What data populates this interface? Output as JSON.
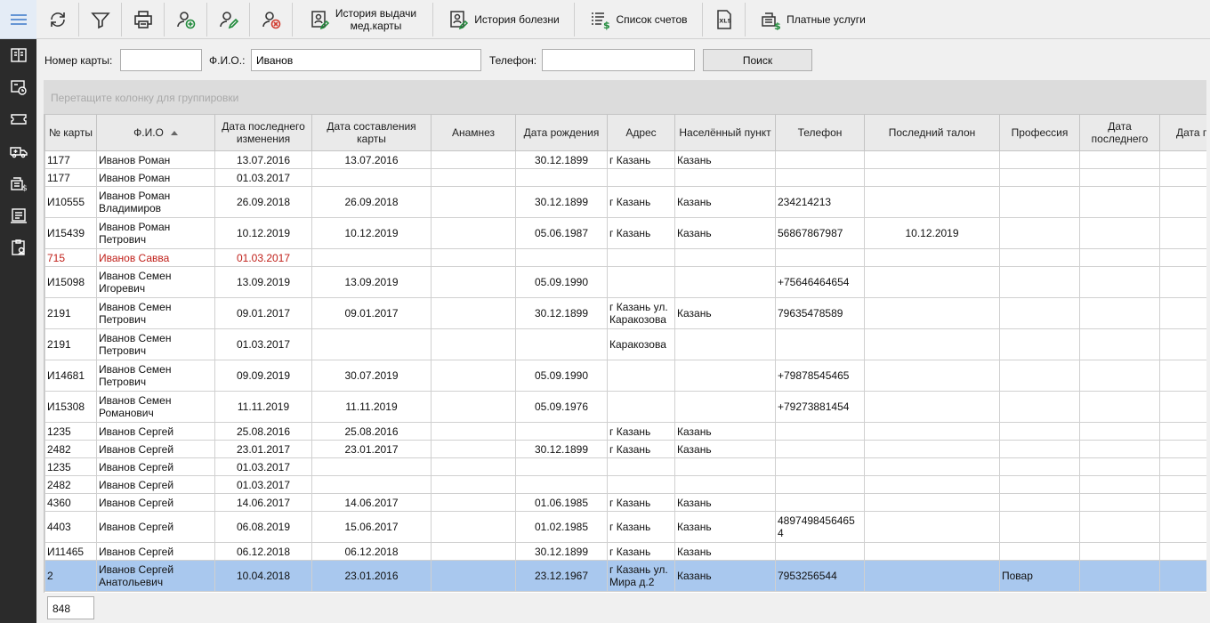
{
  "toolbar": {
    "refresh_icon": "refresh-icon",
    "filter_icon": "filter-icon",
    "print_icon": "print-icon",
    "add_patient_icon": "add-patient-icon",
    "edit_patient_icon": "edit-patient-icon",
    "delete_patient_icon": "delete-patient-icon",
    "issue_history_label": "История выдачи\nмед.карты",
    "disease_history_label": "История болезни",
    "invoices_label": "Список счетов",
    "xls_label": "XLS",
    "paid_services_label": "Платные услуги"
  },
  "search": {
    "card_label": "Номер карты:",
    "card_value": "",
    "fio_label": "Ф.И.О.:",
    "fio_value": "Иванов",
    "phone_label": "Телефон:",
    "phone_value": "",
    "search_button": "Поиск"
  },
  "group_panel_text": "Перетащите колонку для группировки",
  "columns": [
    "№ карты",
    "Ф.И.О",
    "Дата последнего изменения",
    "Дата составления карты",
    "Анамнез",
    "Дата рождения",
    "Адрес",
    "Населённый пункт",
    "Телефон",
    "Последний талон",
    "Профессия",
    "Дата последнего",
    "Дата п"
  ],
  "rows": [
    [
      "1177",
      "Иванов Роман",
      "13.07.2016",
      "13.07.2016",
      "",
      "30.12.1899",
      "г Казань",
      "Казань",
      "",
      "",
      "",
      "",
      ""
    ],
    [
      "1177",
      "Иванов Роман",
      "01.03.2017",
      "",
      "",
      "",
      "",
      "",
      "",
      "",
      "",
      "",
      ""
    ],
    [
      "И10555",
      "Иванов Роман\nВладимиров",
      "26.09.2018",
      "26.09.2018",
      "",
      "30.12.1899",
      "г Казань",
      "Казань",
      "234214213",
      "",
      "",
      "",
      ""
    ],
    [
      "И15439",
      "Иванов Роман\nПетрович",
      "10.12.2019",
      "10.12.2019",
      "",
      "05.06.1987",
      "г Казань",
      "Казань",
      "56867867987",
      "10.12.2019",
      "",
      "",
      ""
    ],
    [
      "715",
      "Иванов Савва",
      "01.03.2017",
      "",
      "",
      "",
      "",
      "",
      "",
      "",
      "",
      "",
      ""
    ],
    [
      "И15098",
      "Иванов Семен\nИгоревич",
      "13.09.2019",
      "13.09.2019",
      "",
      "05.09.1990",
      "",
      "",
      "+75646464654",
      "",
      "",
      "",
      ""
    ],
    [
      "2191",
      "Иванов Семен\nПетрович",
      "09.01.2017",
      "09.01.2017",
      "",
      "30.12.1899",
      "г Казань ул.\nКаракозова",
      "Казань",
      "79635478589",
      "",
      "",
      "",
      ""
    ],
    [
      "2191",
      "Иванов Семен\nПетрович",
      "01.03.2017",
      "",
      "",
      "",
      "Каракозова",
      "",
      "",
      "",
      "",
      "",
      ""
    ],
    [
      "И14681",
      "Иванов Семен\nПетрович",
      "09.09.2019",
      "30.07.2019",
      "",
      "05.09.1990",
      "",
      "",
      "+79878545465",
      "",
      "",
      "",
      ""
    ],
    [
      "И15308",
      "Иванов Семен\nРоманович",
      "11.11.2019",
      "11.11.2019",
      "",
      "05.09.1976",
      "",
      "",
      "+79273881454",
      "",
      "",
      "",
      ""
    ],
    [
      "1235",
      "Иванов Сергей",
      "25.08.2016",
      "25.08.2016",
      "",
      "",
      "г Казань",
      "Казань",
      "",
      "",
      "",
      "",
      ""
    ],
    [
      "2482",
      "Иванов Сергей",
      "23.01.2017",
      "23.01.2017",
      "",
      "30.12.1899",
      "г Казань",
      "Казань",
      "",
      "",
      "",
      "",
      ""
    ],
    [
      "1235",
      "Иванов Сергей",
      "01.03.2017",
      "",
      "",
      "",
      "",
      "",
      "",
      "",
      "",
      "",
      ""
    ],
    [
      "2482",
      "Иванов Сергей",
      "01.03.2017",
      "",
      "",
      "",
      "",
      "",
      "",
      "",
      "",
      "",
      ""
    ],
    [
      "4360",
      "Иванов Сергей",
      "14.06.2017",
      "14.06.2017",
      "",
      "01.06.1985",
      "г Казань",
      "Казань",
      "",
      "",
      "",
      "",
      ""
    ],
    [
      "4403",
      "Иванов Сергей",
      "06.08.2019",
      "15.06.2017",
      "",
      "01.02.1985",
      "г Казань",
      "Казань",
      "4897498456465\n4",
      "",
      "",
      "",
      ""
    ],
    [
      "И11465",
      "Иванов Сергей",
      "06.12.2018",
      "06.12.2018",
      "",
      "30.12.1899",
      "г Казань",
      "Казань",
      "",
      "",
      "",
      "",
      ""
    ],
    [
      "2",
      "Иванов Сергей\nАнатольевич",
      "10.04.2018",
      "23.01.2016",
      "",
      "23.12.1967",
      "г Казань ул.\nМира д.2",
      "Казань",
      "7953256544",
      "",
      "Повар",
      "",
      ""
    ]
  ],
  "row_styles": [
    "h1",
    "h1",
    "h2",
    "h2",
    "h1 red",
    "h2",
    "h2",
    "h2",
    "h2",
    "h2",
    "h1",
    "h1",
    "h1",
    "h1",
    "h1",
    "h2",
    "h1",
    "h2 sel"
  ],
  "footer": {
    "record_count": "848"
  },
  "colors": {
    "accent_selection": "#a9c8ee",
    "deleted_row_text": "#c0201a",
    "sidebar_bg": "#2b2b2b",
    "toolbar_bg": "#f0f0f0"
  }
}
